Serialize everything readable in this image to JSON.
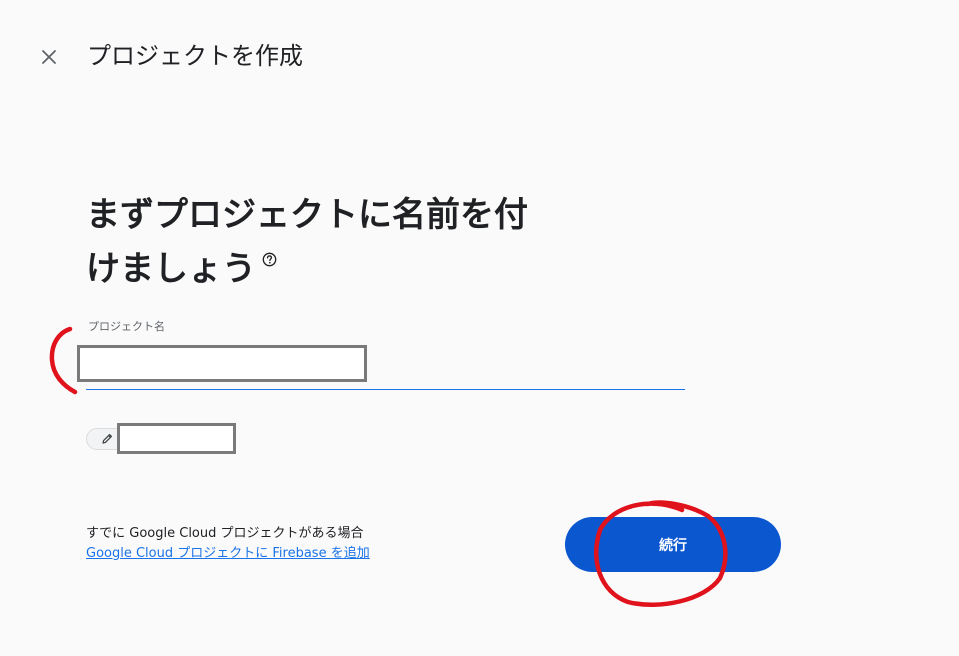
{
  "header": {
    "title": "プロジェクトを作成",
    "close_icon": "close-icon"
  },
  "main": {
    "headline_line1": "まずプロジェクトに名前を付",
    "headline_line2": "けましょう",
    "help_icon": "help-circle-icon",
    "project_name_field": {
      "label": "プロジェクト名",
      "value": ""
    },
    "project_id_chip": {
      "icon": "pencil-icon",
      "value": ""
    },
    "existing_project_text": "すでに Google Cloud プロジェクトがある場合",
    "existing_project_link": "Google Cloud プロジェクトに Firebase を追加",
    "continue_label": "続行"
  },
  "colors": {
    "accent": "#0b57d0",
    "link": "#1a73e8",
    "annotation": "#e0121b",
    "redaction_border": "#7a7a7a"
  }
}
